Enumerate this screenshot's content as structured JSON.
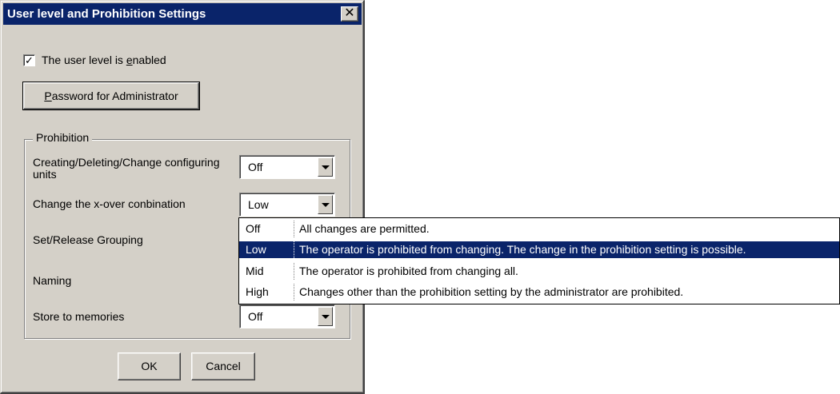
{
  "dialog": {
    "title": "User level and Prohibition Settings",
    "close_glyph": "✕",
    "checkbox": {
      "label_pre": "The user level is ",
      "label_accel": "e",
      "label_post": "nabled",
      "checked": true,
      "check_glyph": "✓"
    },
    "password_button": {
      "accel": "P",
      "label_rest": "assword for Administrator"
    },
    "prohibition": {
      "title": "Prohibition",
      "rows": [
        {
          "label": "Creating/Deleting/Change configuring units",
          "value": "Off"
        },
        {
          "label": "Change the x-over conbination",
          "value": "Low"
        },
        {
          "label": "Set/Release Grouping",
          "value": ""
        },
        {
          "label": "Naming",
          "value": ""
        },
        {
          "label": "Store to memories",
          "value": "Off"
        }
      ]
    },
    "dropdown": {
      "options": [
        {
          "code": "Off",
          "description": "All changes are permitted.",
          "selected": false
        },
        {
          "code": "Low",
          "description": "The operator is prohibited from changing. The change in the prohibition setting is possible.",
          "selected": true
        },
        {
          "code": "Mid",
          "description": "The operator is prohibited from changing all.",
          "selected": false
        },
        {
          "code": "High",
          "description": "Changes other than the prohibition setting by the administrator are prohibited.",
          "selected": false
        }
      ]
    },
    "ok_label": "OK",
    "cancel_label": "Cancel"
  },
  "colors": {
    "face": "#d4d0c8",
    "titlebar": "#0a246a",
    "selection": "#0a246a"
  }
}
